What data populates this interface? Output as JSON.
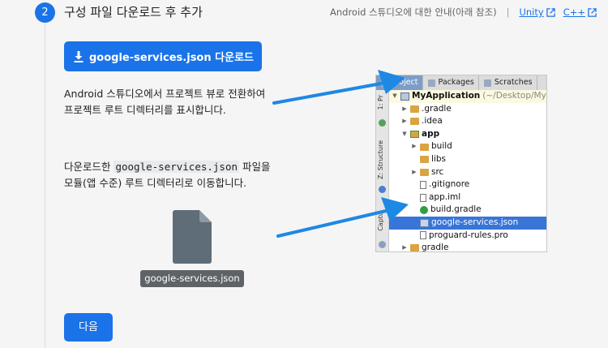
{
  "header": {
    "step_number": "2",
    "step_title": "구성 파일 다운로드 후 추가",
    "guide_text": "Android 스튜디오에 대한 안내(아래 참조)",
    "separator": "|",
    "link_unity": "Unity",
    "link_cpp": "C++"
  },
  "download_button": {
    "label": "google-services.json 다운로드"
  },
  "instruction_1": {
    "line1": "Android 스튜디오에서 프로젝트 뷰로 전환하여",
    "line2": "프로젝트 루트 디렉터리를 표시합니다."
  },
  "instruction_2": {
    "prefix": "다운로드한 ",
    "code": "google-services.json",
    "suffix": " 파일을",
    "line2": "모듈(앱 수준) 루트 디렉터리로 이동합니다."
  },
  "file_label": "google-services.json",
  "next_button": {
    "label": "다음"
  },
  "ide": {
    "tabs": [
      "Project",
      "Packages",
      "Scratches"
    ],
    "side_labels": [
      "1: Pr",
      "Z: Structure",
      "Captu"
    ],
    "tree": [
      {
        "label": "MyApplication",
        "suffix": "(~/Desktop/My"
      },
      {
        "label": ".gradle"
      },
      {
        "label": ".idea"
      },
      {
        "label": "app"
      },
      {
        "label": "build"
      },
      {
        "label": "libs"
      },
      {
        "label": "src"
      },
      {
        "label": ".gitignore"
      },
      {
        "label": "app.iml"
      },
      {
        "label": "build.gradle"
      },
      {
        "label": "google-services.json"
      },
      {
        "label": "proguard-rules.pro"
      },
      {
        "label": "gradle"
      }
    ]
  },
  "colors": {
    "accent": "#1a73e8",
    "arrow": "#1e88e5",
    "selection": "#3875d7",
    "file_icon": "#5f6d78"
  }
}
